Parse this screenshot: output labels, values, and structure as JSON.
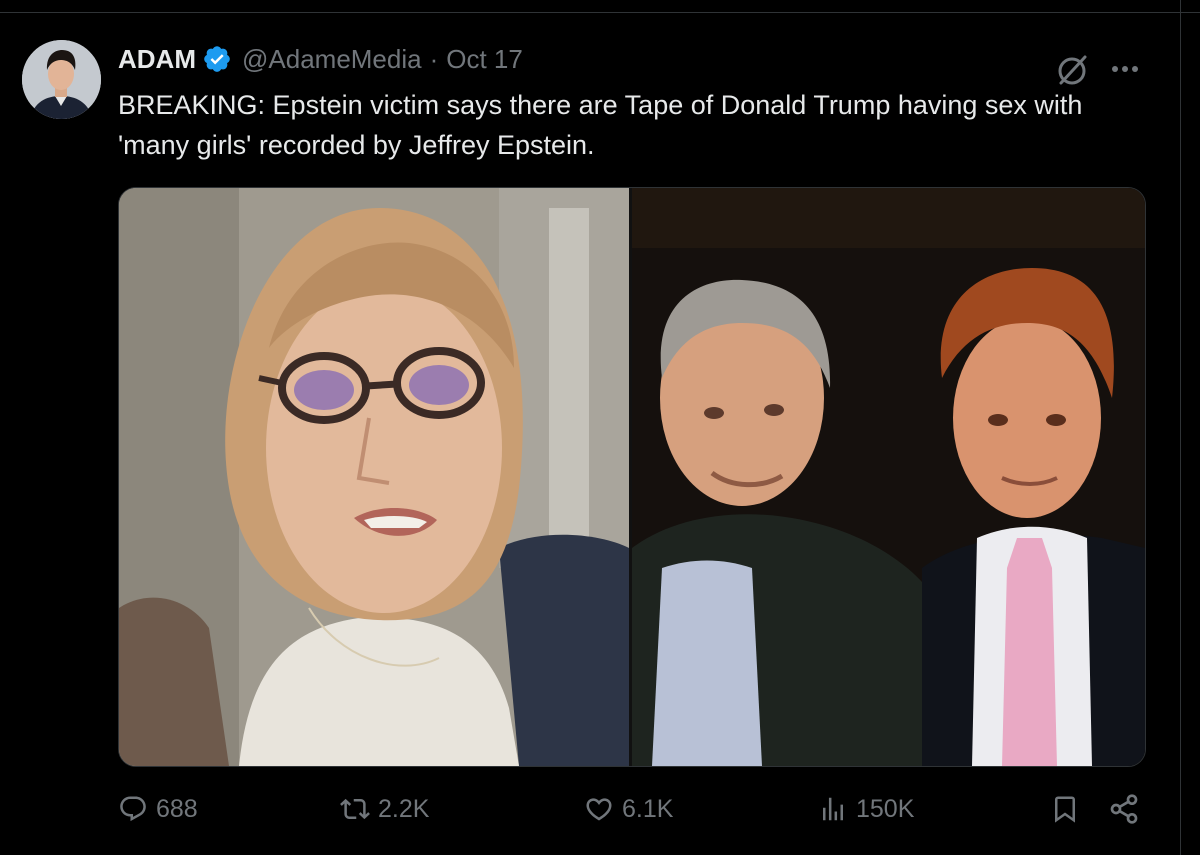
{
  "tweet": {
    "author": {
      "display_name": "ADAM",
      "handle": "@AdameMedia",
      "verified": true
    },
    "separator": "·",
    "date": "Oct 17",
    "text": "BREAKING: Epstein victim says there are Tape of Donald Trump having sex with 'many girls' recorded by Jeffrey Epstein.",
    "media": {
      "count": 2
    },
    "stats": {
      "replies": "688",
      "reposts": "2.2K",
      "likes": "6.1K",
      "views": "150K"
    }
  },
  "icons": {
    "verified": "verified-badge-icon",
    "grok": "grok-icon",
    "more": "more-icon",
    "reply": "reply-icon",
    "repost": "repost-icon",
    "like": "heart-icon",
    "views": "analytics-icon",
    "bookmark": "bookmark-icon",
    "share": "share-icon"
  },
  "colors": {
    "background": "#000000",
    "text_primary": "#e7e9ea",
    "text_secondary": "#71767b",
    "verified_blue": "#1d9bf0",
    "divider": "#2f3336"
  }
}
